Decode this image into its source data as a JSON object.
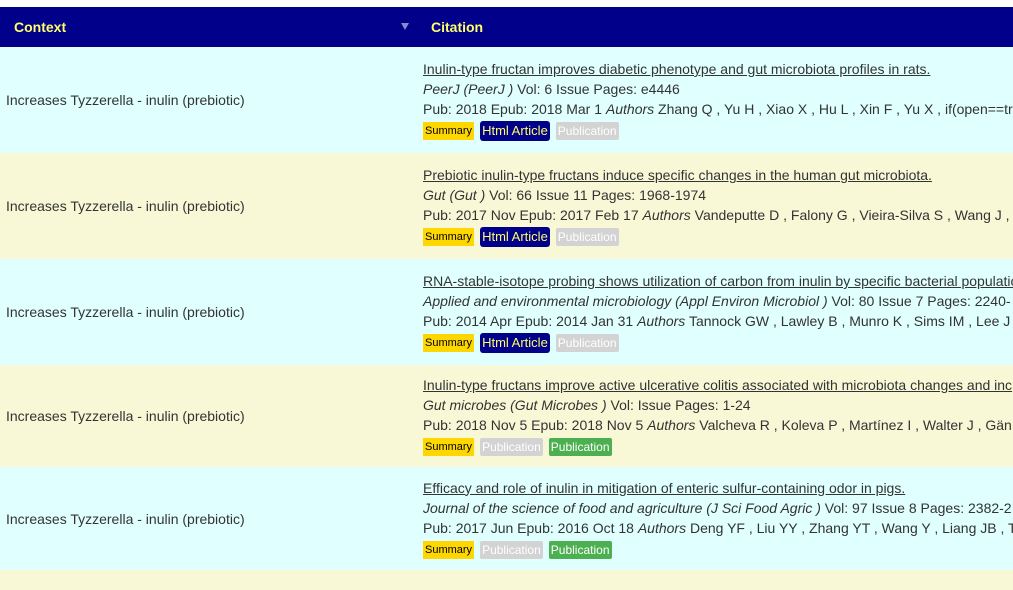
{
  "header": {
    "context_label": "Context",
    "citation_label": "Citation"
  },
  "rows": [
    {
      "context": "Increases Tyzzerella - inulin (prebiotic)",
      "title": "Inulin-type fructan improves diabetic phenotype and gut microbiota profiles in rats.",
      "journal": "PeerJ (PeerJ )",
      "volume_info": " Vol: 6 Issue Pages: e4446",
      "pub": "Pub: 2018 Epub: 2018 Mar 1 ",
      "authors_label": "Authors",
      "authors": " Zhang Q , Yu H , Xiao X , Hu L , Xin F , Yu X , if(open==tr",
      "summary": "Summary",
      "html_article": "Html Article",
      "publication": "Publication"
    },
    {
      "context": "Increases Tyzzerella - inulin (prebiotic)",
      "title": "Prebiotic inulin-type fructans induce specific changes in the human gut microbiota.",
      "journal": "Gut (Gut )",
      "volume_info": " Vol: 66 Issue 11 Pages: 1968-1974",
      "pub": "Pub: 2017 Nov Epub: 2017 Feb 17 ",
      "authors_label": "Authors",
      "authors": " Vandeputte D , Falony G , Vieira-Silva S , Wang J ,",
      "summary": "Summary",
      "html_article": "Html Article",
      "publication": "Publication"
    },
    {
      "context": "Increases Tyzzerella - inulin (prebiotic)",
      "title": "RNA-stable-isotope probing shows utilization of carbon from inulin by specific bacterial populatio",
      "journal": "Applied and environmental microbiology (Appl Environ Microbiol )",
      "volume_info": " Vol: 80 Issue 7 Pages: 2240-",
      "pub": "Pub: 2014 Apr Epub: 2014 Jan 31 ",
      "authors_label": "Authors",
      "authors": " Tannock GW , Lawley B , Munro K , Sims IM , Lee J",
      "summary": "Summary",
      "html_article": "Html Article",
      "publication": "Publication"
    },
    {
      "context": "Increases Tyzzerella - inulin (prebiotic)",
      "title": "Inulin-type fructans improve active ulcerative colitis associated with microbiota changes and inc",
      "journal": "Gut microbes (Gut Microbes )",
      "volume_info": " Vol: Issue Pages: 1-24",
      "pub": "Pub: 2018 Nov 5 Epub: 2018 Nov 5 ",
      "authors_label": "Authors",
      "authors": " Valcheva R , Koleva P , Martínez I , Walter J , Gän",
      "summary": "Summary",
      "publication_grey": "Publication",
      "publication_green": "Publication"
    },
    {
      "context": "Increases Tyzzerella - inulin (prebiotic)",
      "title": "Efficacy and role of inulin in mitigation of enteric sulfur-containing odor in pigs.",
      "journal": "Journal of the science of food and agriculture (J Sci Food Agric )",
      "volume_info": " Vol: 97 Issue 8 Pages: 2382-2",
      "pub": "Pub: 2017 Jun Epub: 2016 Oct 18 ",
      "authors_label": "Authors",
      "authors": " Deng YF , Liu YY , Zhang YT , Wang Y , Liang JB , T",
      "summary": "Summary",
      "publication_grey": "Publication",
      "publication_green": "Publication"
    }
  ],
  "colors": {
    "header_bg": "#00008b",
    "header_text": "#ffff66",
    "row_odd": "#e0ffff",
    "row_even": "#f8f8d6",
    "summary_bg": "#ffd700",
    "publication_green": "#4caf50"
  },
  "icons": {
    "sort": "chevron-down-icon"
  }
}
